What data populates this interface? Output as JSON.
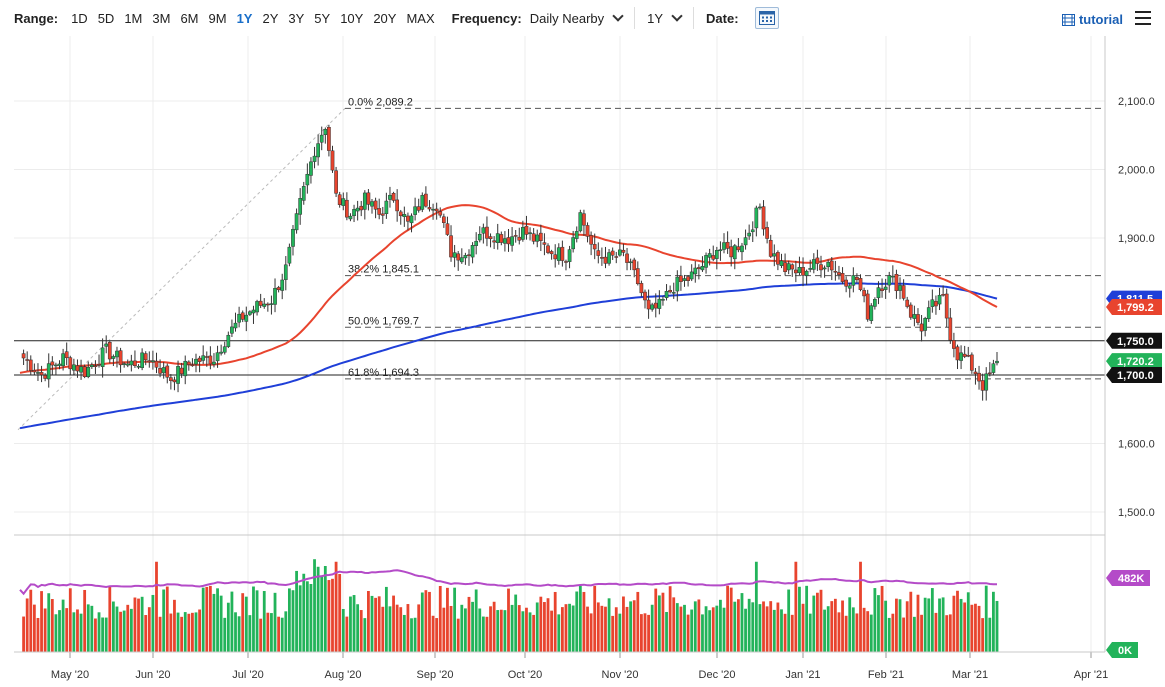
{
  "toolbar": {
    "range_label": "Range:",
    "ranges": [
      "1D",
      "5D",
      "1M",
      "3M",
      "6M",
      "9M",
      "1Y",
      "2Y",
      "3Y",
      "5Y",
      "10Y",
      "20Y",
      "MAX"
    ],
    "active_range": "1Y",
    "frequency_label": "Frequency:",
    "frequency_value": "Daily Nearby",
    "period_value": "1Y",
    "date_label": "Date:",
    "calendar_icon": "calendar-icon",
    "tutorial_label": "tutorial",
    "tutorial_icon": "film-icon",
    "menu_icon": "hamburger-menu-icon"
  },
  "chart_data": {
    "type": "candlestick",
    "x_ticks": [
      "May '20",
      "Jun '20",
      "Jul '20",
      "Aug '20",
      "Sep '20",
      "Oct '20",
      "Nov '20",
      "Dec '20",
      "Jan '21",
      "Feb '21",
      "Mar '21",
      "Apr '21"
    ],
    "y_ticks": [
      "2,100.0",
      "2,000.0",
      "1,900.0",
      "1,600.0",
      "1,500.0"
    ],
    "ylim": [
      1480,
      2130
    ],
    "fibonacci": [
      {
        "label": "0.0% 2,089.2",
        "value": 2089.2
      },
      {
        "label": "38.2% 1,845.1",
        "value": 1845.1
      },
      {
        "label": "50.0% 1,769.7",
        "value": 1769.7
      },
      {
        "label": "61.8% 1,694.3",
        "value": 1694.3
      }
    ],
    "horizontal_lines": [
      {
        "value": 1750.0,
        "label": "1,750.0"
      },
      {
        "value": 1700.0,
        "label": "1,700.0"
      }
    ],
    "price_tags": [
      {
        "label": "1,811.5",
        "value": 1811.5,
        "color": "#1f3fd8"
      },
      {
        "label": "1,799.2",
        "value": 1799.2,
        "color": "#e8442e"
      },
      {
        "label": "1,750.0",
        "value": 1750.0,
        "color": "#111111"
      },
      {
        "label": "1,720.2",
        "value": 1720.2,
        "color": "#22b35a"
      },
      {
        "label": "1,700.0",
        "value": 1700.0,
        "color": "#111111"
      }
    ],
    "close_anchors": [
      [
        0,
        1730
      ],
      [
        6,
        1700
      ],
      [
        12,
        1725
      ],
      [
        18,
        1705
      ],
      [
        24,
        1735
      ],
      [
        30,
        1715
      ],
      [
        36,
        1725
      ],
      [
        42,
        1695
      ],
      [
        48,
        1720
      ],
      [
        54,
        1725
      ],
      [
        58,
        1760
      ],
      [
        62,
        1785
      ],
      [
        66,
        1800
      ],
      [
        70,
        1810
      ],
      [
        74,
        1855
      ],
      [
        78,
        1950
      ],
      [
        82,
        2030
      ],
      [
        85,
        2065
      ],
      [
        88,
        1960
      ],
      [
        92,
        1935
      ],
      [
        96,
        1955
      ],
      [
        100,
        1935
      ],
      [
        104,
        1960
      ],
      [
        108,
        1920
      ],
      [
        112,
        1955
      ],
      [
        116,
        1950
      ],
      [
        120,
        1880
      ],
      [
        124,
        1875
      ],
      [
        128,
        1910
      ],
      [
        132,
        1905
      ],
      [
        136,
        1900
      ],
      [
        140,
        1910
      ],
      [
        144,
        1895
      ],
      [
        148,
        1880
      ],
      [
        152,
        1875
      ],
      [
        156,
        1935
      ],
      [
        160,
        1875
      ],
      [
        164,
        1870
      ],
      [
        168,
        1875
      ],
      [
        172,
        1835
      ],
      [
        175,
        1790
      ],
      [
        178,
        1800
      ],
      [
        182,
        1830
      ],
      [
        186,
        1840
      ],
      [
        190,
        1860
      ],
      [
        194,
        1885
      ],
      [
        198,
        1880
      ],
      [
        202,
        1900
      ],
      [
        206,
        1945
      ],
      [
        209,
        1880
      ],
      [
        213,
        1855
      ],
      [
        217,
        1850
      ],
      [
        221,
        1860
      ],
      [
        225,
        1865
      ],
      [
        229,
        1840
      ],
      [
        233,
        1840
      ],
      [
        236,
        1790
      ],
      [
        239,
        1830
      ],
      [
        242,
        1840
      ],
      [
        245,
        1830
      ],
      [
        248,
        1790
      ],
      [
        251,
        1770
      ],
      [
        254,
        1800
      ],
      [
        257,
        1810
      ],
      [
        259,
        1760
      ],
      [
        261,
        1730
      ],
      [
        263,
        1725
      ],
      [
        266,
        1705
      ],
      [
        268,
        1685
      ],
      [
        270,
        1700
      ],
      [
        272,
        1720.2
      ]
    ],
    "ma_50": {
      "color": "#e8442e",
      "last_value": 1799.2
    },
    "ma_200": {
      "color": "#1f3fd8",
      "last_value": 1811.5
    },
    "volume": {
      "label": "482K",
      "zero_label": "0K",
      "avg_line_color": "#b44bc8",
      "up_color": "#22b35a",
      "down_color": "#e8442e"
    }
  }
}
